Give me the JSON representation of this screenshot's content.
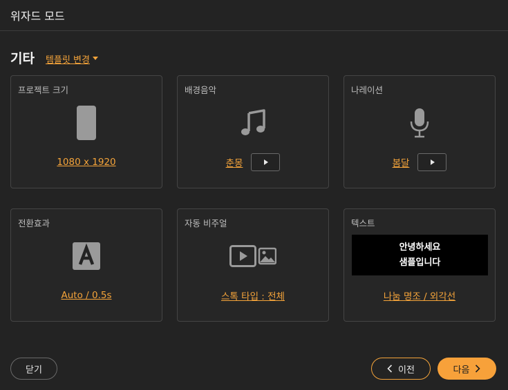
{
  "window": {
    "title": "위자드 모드"
  },
  "section": {
    "title": "기타",
    "template_link": "템플릿 변경"
  },
  "cards": [
    {
      "label": "프로젝트 크기",
      "icon": "phone-portrait-icon",
      "value": "1080 x 1920"
    },
    {
      "label": "배경음악",
      "icon": "music-note-icon",
      "value": "춘몽",
      "has_play": true
    },
    {
      "label": "나레이션",
      "icon": "microphone-icon",
      "value": "봄달",
      "has_play": true
    },
    {
      "label": "전환효과",
      "icon": "letter-a-icon",
      "value": "Auto / 0.5s"
    },
    {
      "label": "자동 비주얼",
      "icon": "video-image-icon",
      "value": "스톡 타입 : 전체"
    },
    {
      "label": "텍스트",
      "preview_lines": [
        "안녕하세요",
        "샘플입니다"
      ],
      "value": "나눔 명조 / 외각선"
    }
  ],
  "footer": {
    "close_label": "닫기",
    "prev_label": "이전",
    "next_label": "다음"
  },
  "colors": {
    "accent": "#f5a43a",
    "background": "#232323",
    "card_border": "#454545"
  }
}
